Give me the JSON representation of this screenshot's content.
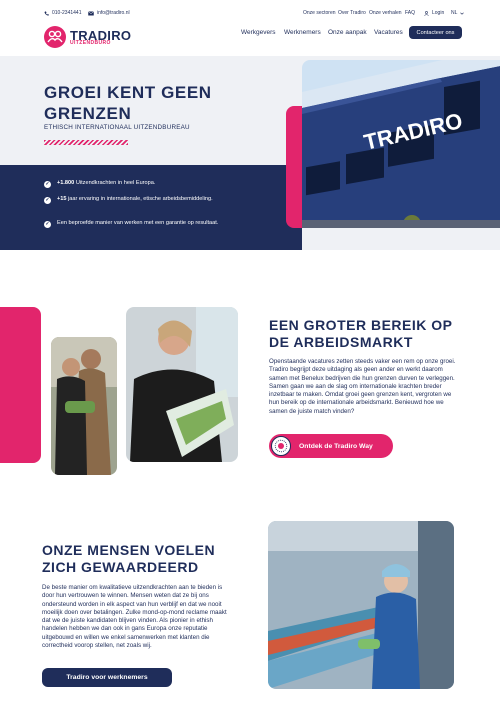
{
  "topbar": {
    "phone": "010-2341441",
    "email": "info@tradiro.nl",
    "links": [
      "Onze sectoren",
      "Over Tradiro",
      "Onze verhalen",
      "FAQ",
      "Login",
      "NL"
    ]
  },
  "header": {
    "logo_name": "TRADIRO",
    "logo_sub": "UITZENDBURO",
    "nav": [
      "Werkgevers",
      "Werknemers",
      "Onze aanpak",
      "Vacatures"
    ],
    "cta": "Contacteer ons"
  },
  "hero": {
    "title": "GROEI KENT GEEN GRENZEN",
    "subtitle": "ETHISCH INTERNATIONAAL UITZENDBUREAU",
    "bullets": [
      {
        "strong": "+1.800",
        "text": " Uitzendkrachten in heel Europa."
      },
      {
        "strong": "+15",
        "text": " jaar ervaring in internationale, etische arbeidsbemiddeling."
      },
      {
        "strong": "",
        "text": "Een beproefde manier van werken met een garantie op resultaat."
      }
    ],
    "building_sign": "TRADIRO"
  },
  "section_reach": {
    "title": "EEN GROTER BEREIK OP DE ARBEIDSMARKT",
    "body": "Openstaande vacatures zetten steeds vaker een rem op onze groei. Tradiro begrijpt deze uitdaging als geen ander en werkt daarom samen met Benelux bedrijven die hun grenzen durven te verleggen. Samen gaan we aan de slag om internationale krachten breder inzetbaar te maken. Omdat groei geen grenzen kent, vergroten we hun bereik op de internationale arbeidsmarkt. Benieuwd hoe we samen de juiste match vinden?",
    "button": "Ontdek de Tradiro Way"
  },
  "section_people": {
    "title": "ONZE MENSEN VOELEN ZICH GEWAARDEERD",
    "body": "De beste manier om kwalitatieve uitzendkrachten aan te bieden is door hun vertrouwen te winnen. Mensen weten dat ze bij ons ondersteund worden in elk aspect van hun verblijf en dat we nooit moeilijk doen over betalingen. Zulke mond-op-mond reclame maakt dat we de juiste kandidaten blijven vinden. Als pionier in ethish handelen hebben we dan ook in gans Europa onze reputatie uitgebouwd en willen we enkel samenwerken met klanten die correctheid voorop stellen, net zoals wij.",
    "button": "Tradiro voor werknemers"
  },
  "colors": {
    "navy": "#1f2d5a",
    "pink": "#e2256c",
    "light_bg": "#eff1f5"
  }
}
